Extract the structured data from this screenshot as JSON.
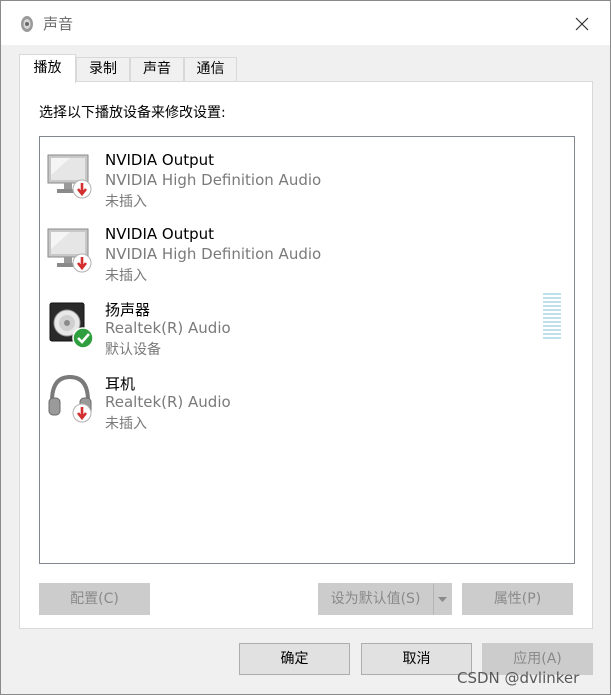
{
  "window": {
    "title": "声音"
  },
  "tabs": [
    {
      "label": "播放",
      "active": true
    },
    {
      "label": "录制",
      "active": false
    },
    {
      "label": "声音",
      "active": false
    },
    {
      "label": "通信",
      "active": false
    }
  ],
  "panel": {
    "instruction": "选择以下播放设备来修改设置:"
  },
  "devices": [
    {
      "name": "NVIDIA Output",
      "driver": "NVIDIA High Definition Audio",
      "status": "未插入",
      "icon": "monitor-icon",
      "badge": "unplugged-badge-icon"
    },
    {
      "name": "NVIDIA Output",
      "driver": "NVIDIA High Definition Audio",
      "status": "未插入",
      "icon": "monitor-icon",
      "badge": "unplugged-badge-icon"
    },
    {
      "name": "扬声器",
      "driver": "Realtek(R) Audio",
      "status": "默认设备",
      "icon": "speaker-icon",
      "badge": "default-check-icon"
    },
    {
      "name": "耳机",
      "driver": "Realtek(R) Audio",
      "status": "未插入",
      "icon": "headphones-icon",
      "badge": "unplugged-badge-icon"
    }
  ],
  "buttons": {
    "configure": "配置(C)",
    "set_default": "设为默认值(S)",
    "properties": "属性(P)",
    "ok": "确定",
    "cancel": "取消",
    "apply": "应用(A)"
  },
  "watermark": "CSDN @dvlinker",
  "colors": {
    "unplugged": "#d32f2f",
    "default_ok": "#2e9e3e",
    "level_meter": "#bfe0ea"
  }
}
